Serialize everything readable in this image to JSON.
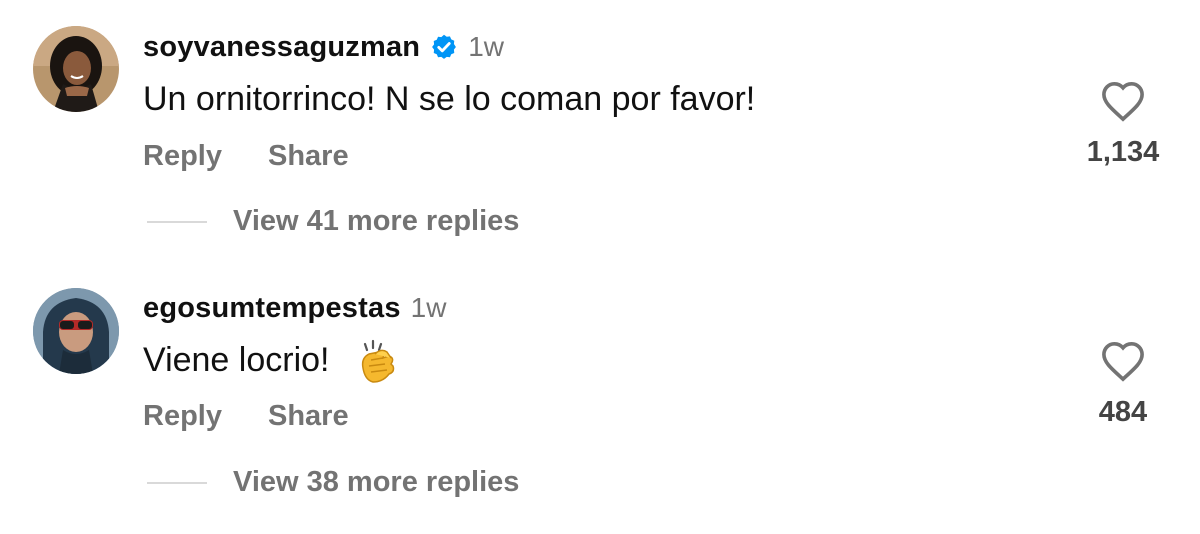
{
  "comments": [
    {
      "username": "soyvanessaguzman",
      "verified": true,
      "timestamp": "1w",
      "text": "Un ornitorrinco! N se lo coman por favor!",
      "reply_label": "Reply",
      "share_label": "Share",
      "like_count": "1,134",
      "view_replies": "View 41 more replies",
      "avatar_icon": "profile-photo-woman"
    },
    {
      "username": "egosumtempestas",
      "verified": false,
      "timestamp": "1w",
      "text": "Viene locrio!",
      "emoji_icon": "clapping-hands-emoji",
      "reply_label": "Reply",
      "share_label": "Share",
      "like_count": "484",
      "view_replies": "View 38 more replies",
      "avatar_icon": "profile-photo-hooded-person"
    }
  ],
  "colors": {
    "text": "#111111",
    "secondary": "#737373",
    "verified_blue": "#0095f6",
    "divider": "#d9d9d9"
  }
}
